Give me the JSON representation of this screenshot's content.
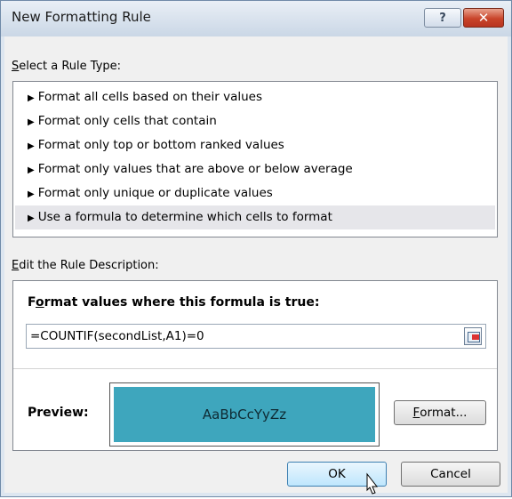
{
  "dialog": {
    "title": "New Formatting Rule",
    "help_label": "?",
    "close_label": "✕"
  },
  "rule_type": {
    "label_prefix": "S",
    "label_rest": "elect a Rule Type:",
    "items": [
      {
        "label": "Format all cells based on their values",
        "selected": false
      },
      {
        "label": "Format only cells that contain",
        "selected": false
      },
      {
        "label": "Format only top or bottom ranked values",
        "selected": false
      },
      {
        "label": "Format only values that are above or below average",
        "selected": false
      },
      {
        "label": "Format only unique or duplicate values",
        "selected": false
      },
      {
        "label": "Use a formula to determine which cells to format",
        "selected": true
      }
    ]
  },
  "description": {
    "label_prefix": "E",
    "label_rest": "dit the Rule Description:",
    "formula_heading_a": "F",
    "formula_heading_u": "o",
    "formula_heading_b": "rmat values where this formula is true:",
    "formula_value": "=COUNTIF(secondList,A1)=0",
    "preview_label": "Preview:",
    "preview_text": "AaBbCcYyZz",
    "preview_fill": "#3ea6bd",
    "format_button_u": "F",
    "format_button_rest": "ormat..."
  },
  "buttons": {
    "ok": "OK",
    "cancel": "Cancel"
  }
}
